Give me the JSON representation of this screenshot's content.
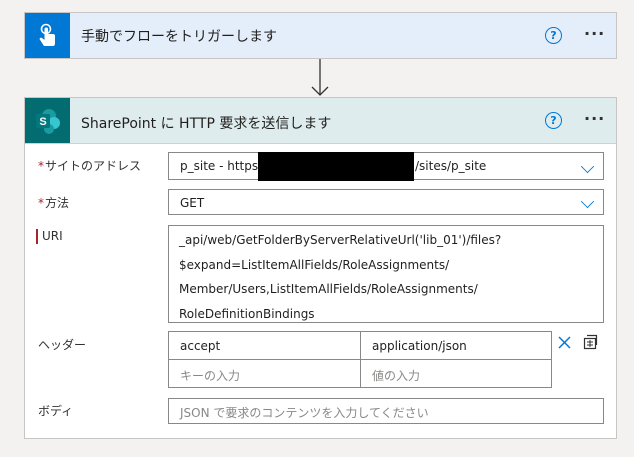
{
  "trigger": {
    "title": "手動でフローをトリガーします",
    "help_icon": "help-circle-icon",
    "more_icon": "more-horizontal-icon",
    "icon": "touch-hand-icon",
    "accent": "#0078d4"
  },
  "action": {
    "title": "SharePoint に HTTP 要求を送信します",
    "icon": "sharepoint-icon",
    "accent": "#036c70",
    "fields": {
      "site": {
        "label": "サイトのアドレス",
        "required": true,
        "value_prefix": "p_site - https://",
        "value_suffix": "/sites/p_site"
      },
      "method": {
        "label": "方法",
        "required": true,
        "value": "GET"
      },
      "uri": {
        "label": "URI",
        "required": true,
        "lines": [
          "_api/web/GetFolderByServerRelativeUrl('lib_01')/files?",
          "$expand=ListItemAllFields/RoleAssignments/",
          "Member/Users,ListItemAllFields/RoleAssignments/",
          "RoleDefinitionBindings"
        ]
      },
      "headers": {
        "label": "ヘッダー",
        "rows": [
          {
            "key": "accept",
            "value": "application/json"
          }
        ],
        "key_placeholder": "キーの入力",
        "value_placeholder": "値の入力"
      },
      "body": {
        "label": "ボディ",
        "placeholder": "JSON で要求のコンテンツを入力してください"
      }
    }
  },
  "required_mark": "*"
}
